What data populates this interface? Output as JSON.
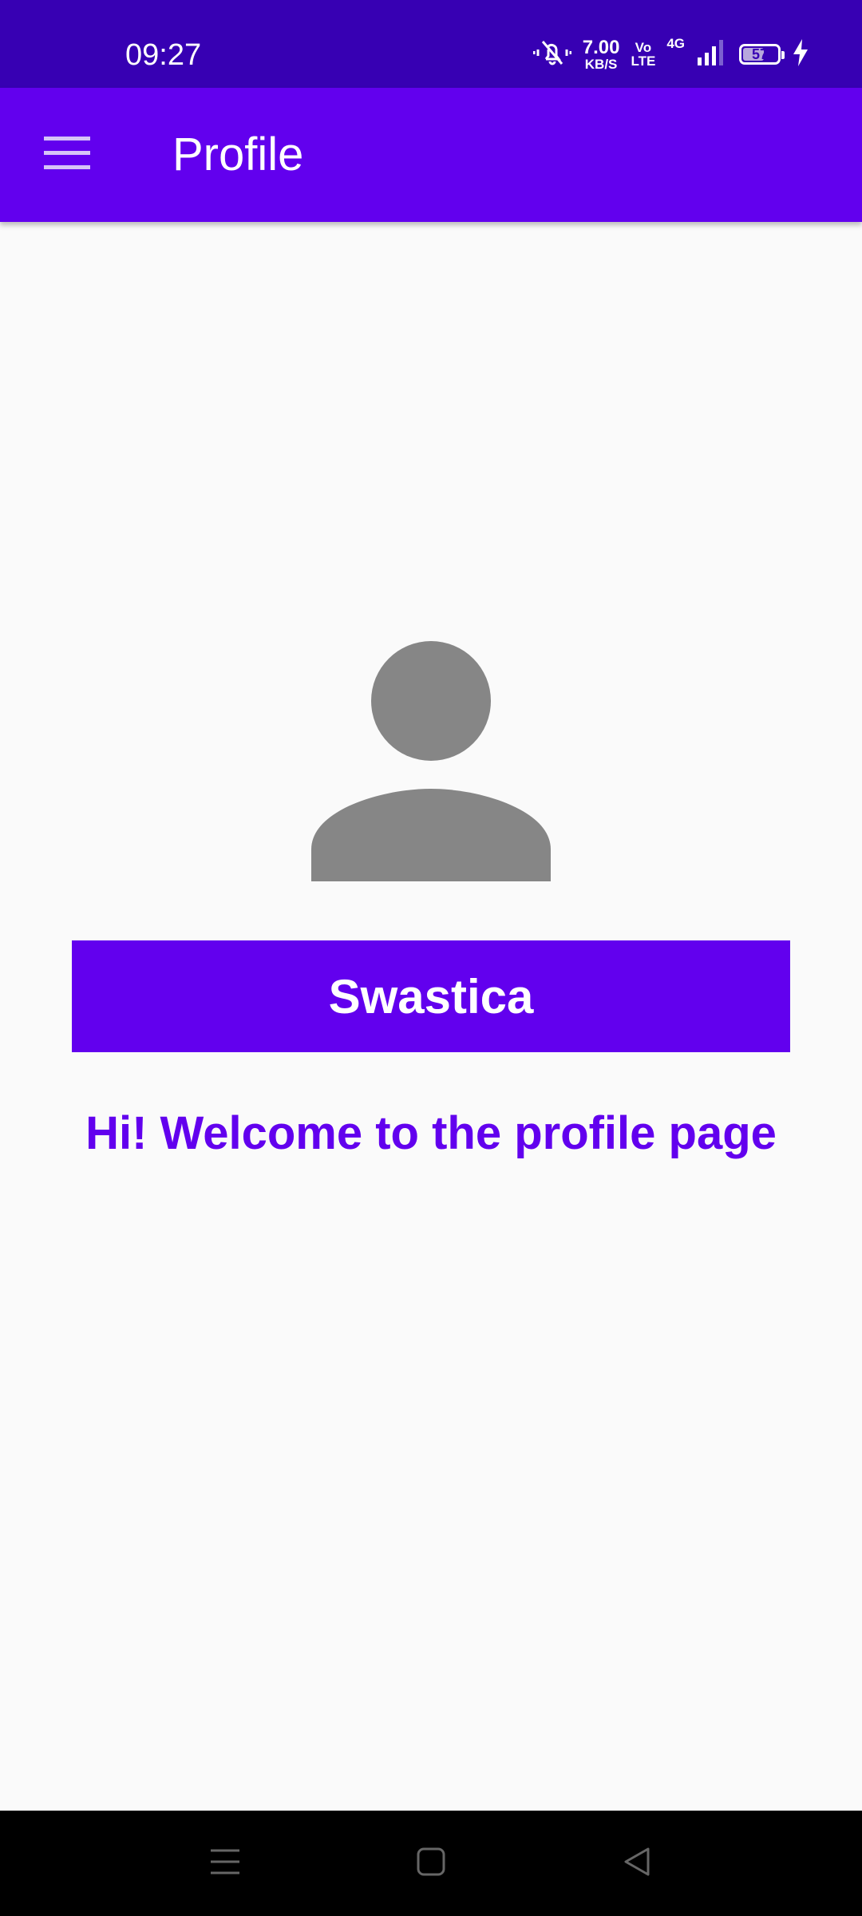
{
  "status_bar": {
    "time": "09:27",
    "net_speed_value": "7.00",
    "net_speed_unit": "KB/S",
    "volte_top": "Vo",
    "volte_bottom": "LTE",
    "network": "4G",
    "battery_level": "57",
    "icons": [
      "mute-vibrate-icon",
      "volte-icon",
      "signal-icon",
      "battery-icon",
      "charging-icon"
    ]
  },
  "app_bar": {
    "title": "Profile",
    "menu_icon": "hamburger-menu-icon"
  },
  "profile": {
    "avatar_icon": "person-icon",
    "name": "Swastica",
    "welcome_message": "Hi! Welcome to the profile page"
  },
  "nav_bar": {
    "icons": [
      "recents-icon",
      "home-icon",
      "back-icon"
    ]
  },
  "colors": {
    "status_bar": "#3700b3",
    "primary": "#6200ee",
    "background": "#fafafa",
    "avatar": "#868686",
    "nav_bar": "#000000"
  }
}
